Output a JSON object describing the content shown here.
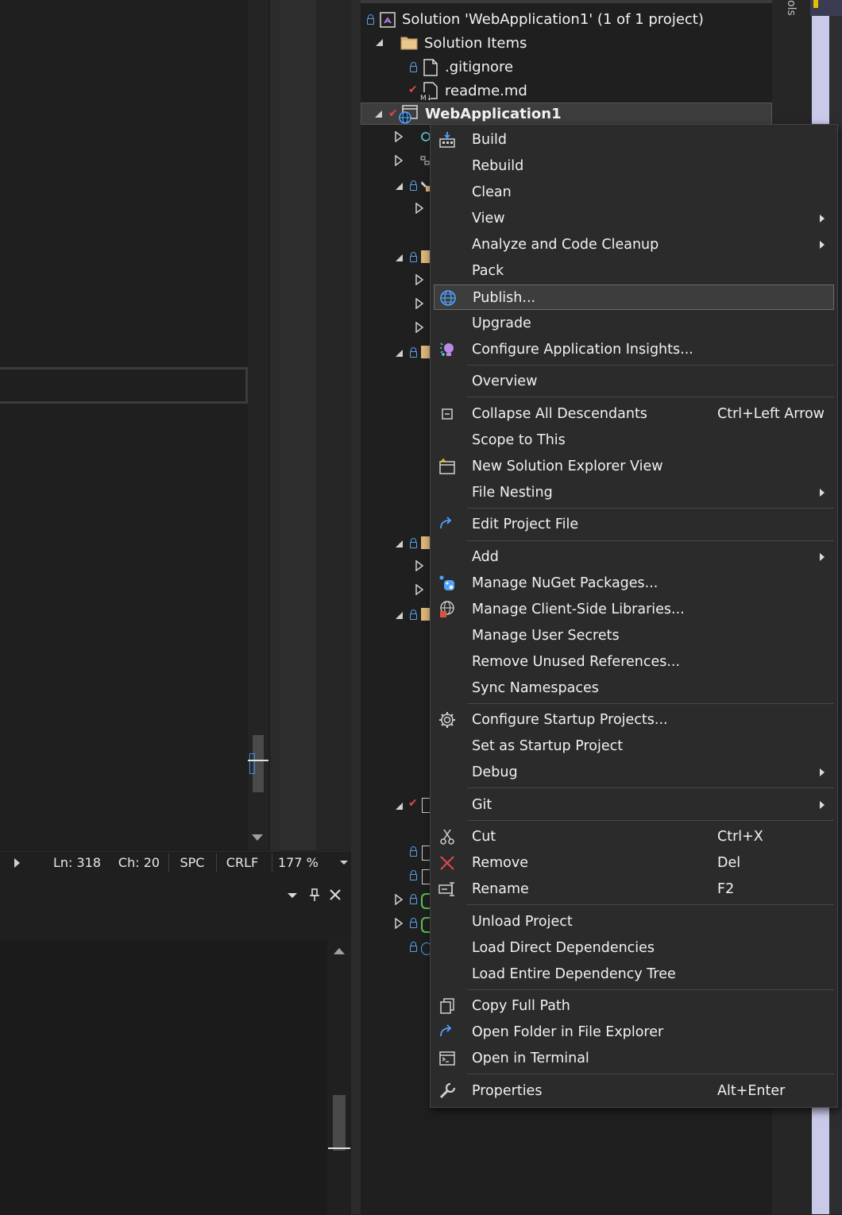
{
  "status_bar": {
    "line": "Ln: 318",
    "column": "Ch: 20",
    "whitespace": "SPC",
    "line_ending": "CRLF",
    "zoom": "177 %"
  },
  "right_strip": {
    "tab_label": "ols"
  },
  "solution_explorer": {
    "solution_label": "Solution 'WebApplication1' (1 of 1 project)",
    "solution_items_label": "Solution Items",
    "gitignore_label": ".gitignore",
    "readme_label": "readme.md",
    "project_label": "WebApplication1"
  },
  "context_menu": {
    "build": "Build",
    "rebuild": "Rebuild",
    "clean": "Clean",
    "view": "View",
    "analyze": "Analyze and Code Cleanup",
    "pack": "Pack",
    "publish": "Publish...",
    "upgrade": "Upgrade",
    "app_insights": "Configure Application Insights...",
    "overview": "Overview",
    "collapse_all": "Collapse All Descendants",
    "collapse_all_shortcut": "Ctrl+Left Arrow",
    "scope_to_this": "Scope to This",
    "new_se_view": "New Solution Explorer View",
    "file_nesting": "File Nesting",
    "edit_project_file": "Edit Project File",
    "add": "Add",
    "manage_nuget": "Manage NuGet Packages...",
    "manage_client_libs": "Manage Client-Side Libraries...",
    "manage_user_secrets": "Manage User Secrets",
    "remove_unused_refs": "Remove Unused References...",
    "sync_namespaces": "Sync Namespaces",
    "configure_startup": "Configure Startup Projects...",
    "set_startup": "Set as Startup Project",
    "debug": "Debug",
    "git": "Git",
    "cut": "Cut",
    "cut_shortcut": "Ctrl+X",
    "remove": "Remove",
    "remove_shortcut": "Del",
    "rename": "Rename",
    "rename_shortcut": "F2",
    "unload_project": "Unload Project",
    "load_direct_deps": "Load Direct Dependencies",
    "load_entire_tree": "Load Entire Dependency Tree",
    "copy_full_path": "Copy Full Path",
    "open_folder": "Open Folder in File Explorer",
    "open_terminal": "Open in Terminal",
    "properties": "Properties",
    "properties_shortcut": "Alt+Enter"
  },
  "colors": {
    "background": "#1f1f1f",
    "menu_background": "#2b2b2b",
    "menu_highlight": "#3d3d3d",
    "accent_blue": "#3a8ee6",
    "git_check_red": "#e04848"
  }
}
